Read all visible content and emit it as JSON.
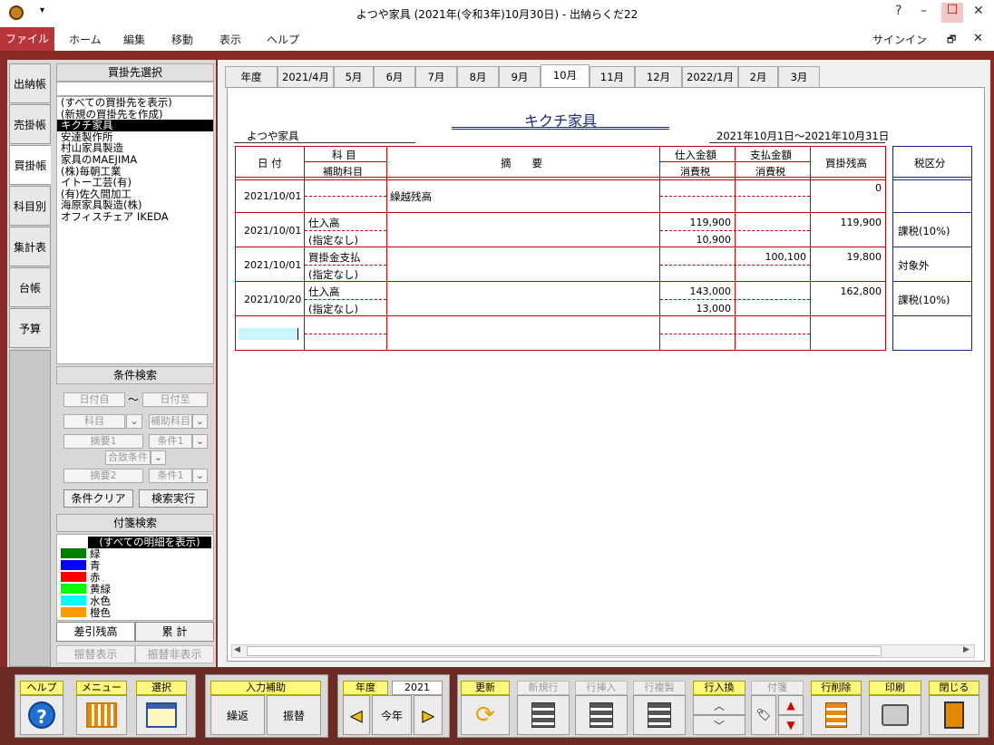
{
  "window": {
    "title": "よつや家具 (2021年(令和3年)10月30日) - 出納らくだ22",
    "help": "?",
    "minimize": "–",
    "maximize": "☐",
    "close": "✕"
  },
  "menu": {
    "file": "ファイル",
    "items": [
      "ホーム",
      "編集",
      "移動",
      "表示",
      "ヘルプ"
    ],
    "signin": "サインイン",
    "min": "–",
    "restore": "🗗",
    "close": "✕"
  },
  "side_tabs": [
    "出納帳",
    "売掛帳",
    "買掛帳",
    "科目別",
    "集計表",
    "台帳",
    "予算"
  ],
  "vendor": {
    "header": "買掛先選択",
    "items": [
      "(すべての買掛先を表示)",
      "(新規の買掛先を作成)",
      "キクチ家具",
      "安達製作所",
      "村山家具製造",
      "家具のMAEJIMA",
      "(株)毎朝工業",
      "イトー工芸(有)",
      "(有)佐久間加工",
      "海原家具製造(株)",
      "オフィスチェア IKEDA"
    ],
    "selected": 2
  },
  "cond": {
    "header": "条件検索",
    "date_from": "日付自",
    "tilde": "〜",
    "date_to": "日付至",
    "account": "科目",
    "sub_account": "補助科目",
    "memo1": "摘要1",
    "cond1": "条件1",
    "match": "合致条件",
    "memo2": "摘要2",
    "cond2": "条件1",
    "clear": "条件クリア",
    "run": "検索実行"
  },
  "tags": {
    "header": "付箋検索",
    "all": "(すべての明細を表示)",
    "items": [
      {
        "label": "緑",
        "color": "#008000"
      },
      {
        "label": "青",
        "color": "#0000ff"
      },
      {
        "label": "赤",
        "color": "#ff0000"
      },
      {
        "label": "黄緑",
        "color": "#00ff00"
      },
      {
        "label": "水色",
        "color": "#00ffff"
      },
      {
        "label": "橙色",
        "color": "#ff9900"
      }
    ]
  },
  "bottom_tabs": {
    "balance": "差引残高",
    "total": "累 計",
    "transfer_show": "振替表示",
    "transfer_hide": "振替非表示"
  },
  "month_tabs": [
    "年度",
    "2021/4月",
    "5月",
    "6月",
    "7月",
    "8月",
    "9月",
    "10月",
    "11月",
    "12月",
    "2022/1月",
    "2月",
    "3月"
  ],
  "active_month": 7,
  "ledger": {
    "vendor": "キクチ家具",
    "company": "よつや家具",
    "period": "2021年10月1日〜2021年10月31日",
    "h_date": "日 付",
    "h_account": "科 目",
    "h_sub": "補助科目",
    "h_memo": "摘　　要",
    "h_purchase": "仕入金額",
    "h_tax": "消費税",
    "h_payment": "支払金額",
    "h_tax2": "消費税",
    "h_balance": "買掛残高",
    "h_taxcat": "税区分",
    "rows": [
      {
        "date": "2021/10/01",
        "account": "",
        "sub": "",
        "memo": "繰越残高",
        "purchase": "",
        "tax": "",
        "payment": "",
        "balance": "0",
        "taxcat": ""
      },
      {
        "date": "2021/10/01",
        "account": "仕入高",
        "sub": "(指定なし)",
        "memo": "",
        "purchase": "119,900",
        "tax": "10,900",
        "payment": "",
        "balance": "119,900",
        "taxcat": "課税(10%)"
      },
      {
        "date": "2021/10/01",
        "account": "買掛金支払",
        "sub": "(指定なし)",
        "memo": "",
        "purchase": "",
        "tax": "",
        "payment": "100,100",
        "balance": "19,800",
        "taxcat": "対象外"
      },
      {
        "date": "2021/10/20",
        "account": "仕入高",
        "sub": "(指定なし)",
        "memo": "",
        "purchase": "143,000",
        "tax": "13,000",
        "payment": "",
        "balance": "162,800",
        "taxcat": "課税(10%)"
      }
    ]
  },
  "toolbar": {
    "help": "ヘルプ",
    "menu": "メニュー",
    "select": "選択",
    "input_assist": "入力補助",
    "repeat": "繰返",
    "transfer": "振替",
    "year": "年度",
    "year_value": "2021",
    "this_year": "今年",
    "update": "更新",
    "new_row": "新規行",
    "insert_row": "行挿入",
    "copy_row": "行複製",
    "swap_row": "行入換",
    "tag": "付箋",
    "delete_row": "行削除",
    "print": "印刷",
    "close": "閉じる"
  }
}
